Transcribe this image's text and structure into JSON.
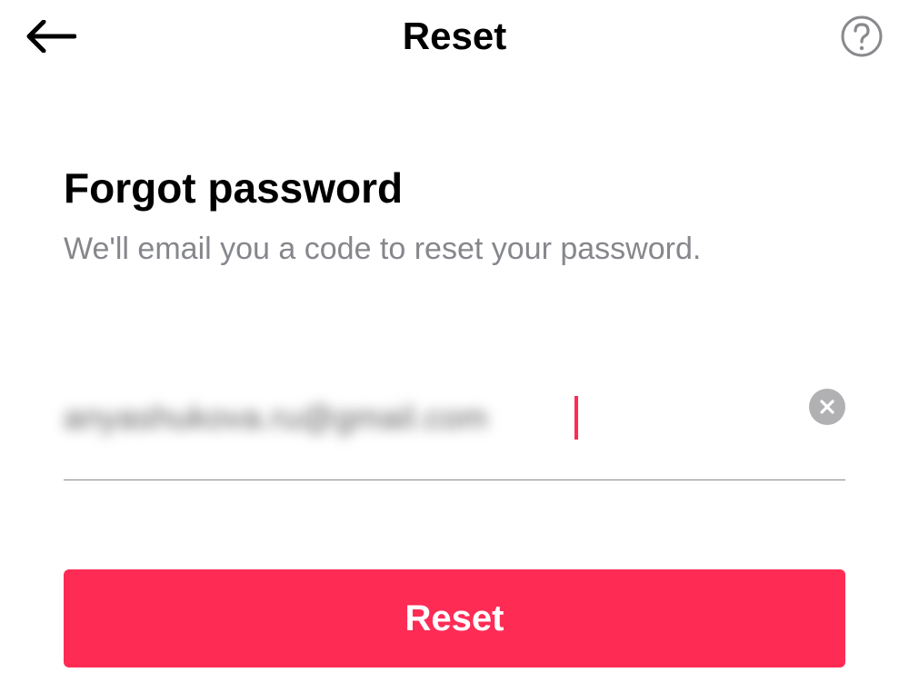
{
  "header": {
    "title": "Reset"
  },
  "main": {
    "heading": "Forgot password",
    "subtext": "We'll email you a code to reset your password.",
    "email_value": "anyashukova.ru@gmail.com",
    "reset_button_label": "Reset"
  },
  "colors": {
    "accent": "#fe2c55",
    "text_muted": "#86878c",
    "clear_bg": "#b1b1b4"
  }
}
